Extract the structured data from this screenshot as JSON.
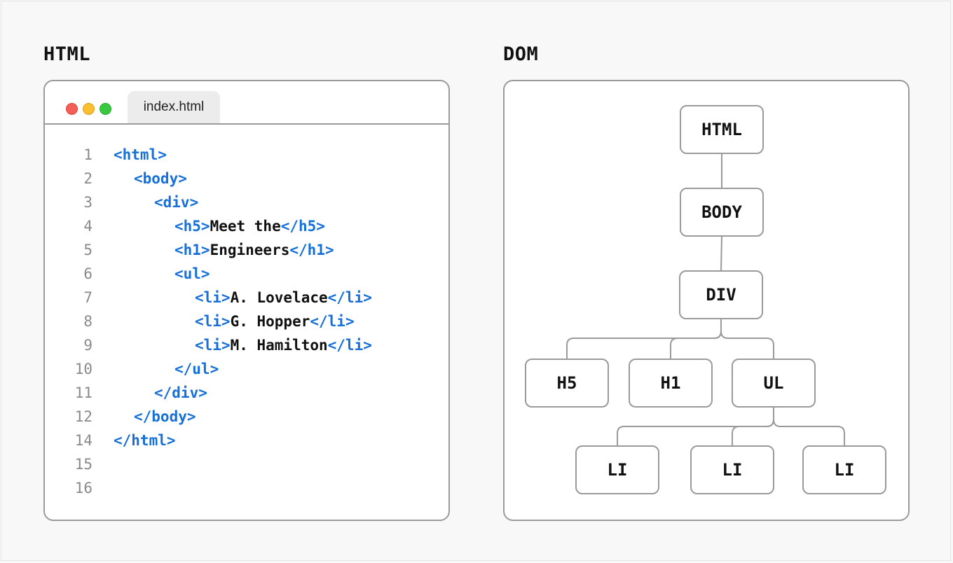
{
  "headings": {
    "left": "HTML",
    "right": "DOM"
  },
  "editor": {
    "tab_label": "index.html",
    "lines": [
      {
        "num": "1",
        "indent": 0,
        "parts": [
          [
            "tag",
            "<html>"
          ]
        ]
      },
      {
        "num": "2",
        "indent": 1,
        "parts": [
          [
            "tag",
            "<body>"
          ]
        ]
      },
      {
        "num": "3",
        "indent": 2,
        "parts": [
          [
            "tag",
            "<div>"
          ]
        ]
      },
      {
        "num": "4",
        "indent": 3,
        "parts": [
          [
            "tag",
            "<h5>"
          ],
          [
            "txt",
            "Meet the"
          ],
          [
            "tag",
            "</h5>"
          ]
        ]
      },
      {
        "num": "5",
        "indent": 3,
        "parts": [
          [
            "tag",
            "<h1>"
          ],
          [
            "txt",
            "Engineers"
          ],
          [
            "tag",
            "</h1>"
          ]
        ]
      },
      {
        "num": "6",
        "indent": 3,
        "parts": [
          [
            "tag",
            "<ul>"
          ]
        ]
      },
      {
        "num": "7",
        "indent": 4,
        "parts": [
          [
            "tag",
            "<li>"
          ],
          [
            "txt",
            "A. Lovelace"
          ],
          [
            "tag",
            "</li>"
          ]
        ]
      },
      {
        "num": "8",
        "indent": 4,
        "parts": [
          [
            "tag",
            "<li>"
          ],
          [
            "txt",
            "G. Hopper"
          ],
          [
            "tag",
            "</li>"
          ]
        ]
      },
      {
        "num": "9",
        "indent": 4,
        "parts": [
          [
            "tag",
            "<li>"
          ],
          [
            "txt",
            "M. Hamilton"
          ],
          [
            "tag",
            "</li>"
          ]
        ]
      },
      {
        "num": "10",
        "indent": 3,
        "parts": [
          [
            "tag",
            "</ul>"
          ]
        ]
      },
      {
        "num": "11",
        "indent": 2,
        "parts": [
          [
            "tag",
            "</div>"
          ]
        ]
      },
      {
        "num": "12",
        "indent": 1,
        "parts": [
          [
            "tag",
            "</body>"
          ]
        ]
      },
      {
        "num": "14",
        "indent": 0,
        "parts": [
          [
            "tag",
            "</html>"
          ]
        ]
      },
      {
        "num": "15",
        "indent": 0,
        "parts": []
      },
      {
        "num": "16",
        "indent": 0,
        "parts": []
      }
    ]
  },
  "dom_tree": {
    "nodes": [
      {
        "id": "html",
        "label": "HTML"
      },
      {
        "id": "body",
        "label": "BODY"
      },
      {
        "id": "div",
        "label": "DIV"
      },
      {
        "id": "h5",
        "label": "H5"
      },
      {
        "id": "h1",
        "label": "H1"
      },
      {
        "id": "ul",
        "label": "UL"
      },
      {
        "id": "li1",
        "label": "LI"
      },
      {
        "id": "li2",
        "label": "LI"
      },
      {
        "id": "li3",
        "label": "LI"
      }
    ],
    "edges": [
      [
        "html",
        "body"
      ],
      [
        "body",
        "div"
      ],
      [
        "div",
        "h5"
      ],
      [
        "div",
        "h1"
      ],
      [
        "div",
        "ul"
      ],
      [
        "ul",
        "li1"
      ],
      [
        "ul",
        "li2"
      ],
      [
        "ul",
        "li3"
      ]
    ]
  },
  "colors": {
    "tag": "#1670d8",
    "text": "#111111",
    "line_number": "#8a8a8a",
    "border": "#9a9a9a"
  }
}
